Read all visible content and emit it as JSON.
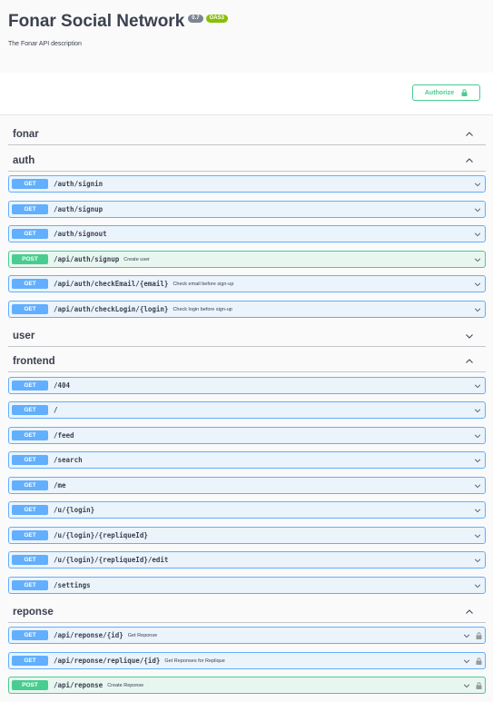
{
  "info": {
    "title": "Fonar Social Network",
    "version": "0.7",
    "oas": "OAS3",
    "description": "The Fonar API description"
  },
  "authorize_label": "Authorize",
  "colors": {
    "get": "#61affe",
    "post": "#49cc90",
    "text": "#3b4151"
  },
  "sections": {
    "fonar": {
      "name": "fonar",
      "expanded": true
    },
    "auth": {
      "name": "auth",
      "expanded": true,
      "ops": [
        {
          "method": "GET",
          "path": "/auth/signin",
          "summary": ""
        },
        {
          "method": "GET",
          "path": "/auth/signup",
          "summary": ""
        },
        {
          "method": "GET",
          "path": "/auth/signout",
          "summary": ""
        },
        {
          "method": "POST",
          "path": "/api/auth/signup",
          "summary": "Create user"
        },
        {
          "method": "GET",
          "path": "/api/auth/checkEmail/{email}",
          "summary": "Check email before sign-up"
        },
        {
          "method": "GET",
          "path": "/api/auth/checkLogin/{login}",
          "summary": "Check login before sign-up"
        }
      ]
    },
    "user": {
      "name": "user",
      "expanded": false
    },
    "frontend": {
      "name": "frontend",
      "expanded": true,
      "ops": [
        {
          "method": "GET",
          "path": "/404",
          "summary": ""
        },
        {
          "method": "GET",
          "path": "/",
          "summary": ""
        },
        {
          "method": "GET",
          "path": "/feed",
          "summary": ""
        },
        {
          "method": "GET",
          "path": "/search",
          "summary": ""
        },
        {
          "method": "GET",
          "path": "/me",
          "summary": ""
        },
        {
          "method": "GET",
          "path": "/u/{login}",
          "summary": ""
        },
        {
          "method": "GET",
          "path": "/u/{login}/{repliqueId}",
          "summary": ""
        },
        {
          "method": "GET",
          "path": "/u/{login}/{repliqueId}/edit",
          "summary": ""
        },
        {
          "method": "GET",
          "path": "/settings",
          "summary": ""
        }
      ]
    },
    "reponse": {
      "name": "reponse",
      "expanded": true,
      "ops": [
        {
          "method": "GET",
          "path": "/api/reponse/{id}",
          "summary": "Get Reponse",
          "locked": true
        },
        {
          "method": "GET",
          "path": "/api/reponse/replique/{id}",
          "summary": "Get Reponses for Replique",
          "locked": true
        },
        {
          "method": "POST",
          "path": "/api/reponse",
          "summary": "Create Reponse",
          "locked": true
        }
      ]
    }
  }
}
